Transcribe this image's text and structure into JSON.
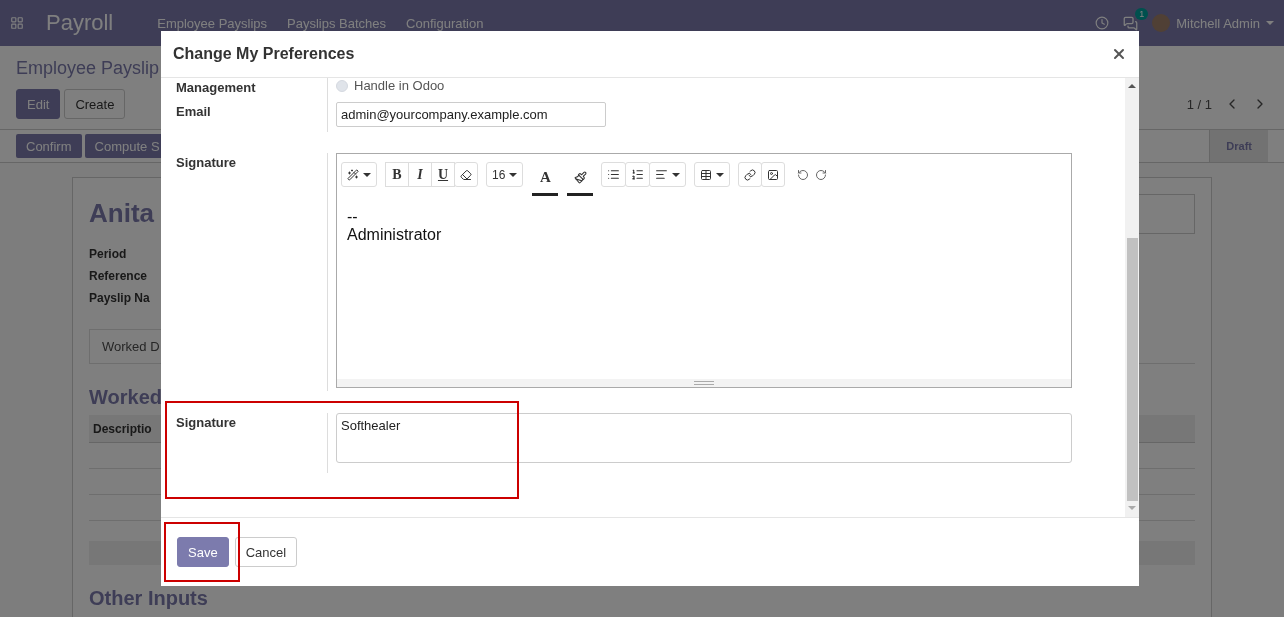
{
  "navbar": {
    "app_title": "Payroll",
    "menu": [
      "Employee Payslips",
      "Payslips Batches",
      "Configuration"
    ],
    "messages_count": "1",
    "user": "Mitchell Admin"
  },
  "control_panel": {
    "breadcrumb": "Employee Payslip",
    "buttons": [
      "Edit",
      "Create"
    ],
    "pager": "1 / 1"
  },
  "statusbar": {
    "buttons": [
      "Confirm",
      "Compute S"
    ],
    "stages": [
      {
        "label": "Draft",
        "selected": true
      }
    ]
  },
  "sheet": {
    "title": "Anita",
    "fields": [
      "Period",
      "Reference",
      "Payslip Na"
    ],
    "tab": "Worked D",
    "section_title": "Worked",
    "table_header": "Descriptio",
    "next_section": "Other Inputs"
  },
  "dialog": {
    "title": "Change My Preferences",
    "management": {
      "label": "Management",
      "option": "Handle in Odoo",
      "checked": false
    },
    "email": {
      "label": "Email",
      "value": "admin@yourcompany.example.com"
    },
    "signature_editor": {
      "label": "Signature",
      "font_size": "16",
      "format_buttons": [
        "B",
        "I",
        "U"
      ],
      "text_color_label": "A",
      "lines": [
        "--",
        "Administrator"
      ]
    },
    "signature_text": {
      "label": "Signature",
      "value": "Softhealer",
      "highlighted": true
    },
    "buttons": [
      {
        "label": "Save",
        "kind": "primary",
        "highlighted": true
      },
      {
        "label": "Cancel",
        "kind": "secondary",
        "highlighted": false
      }
    ]
  }
}
